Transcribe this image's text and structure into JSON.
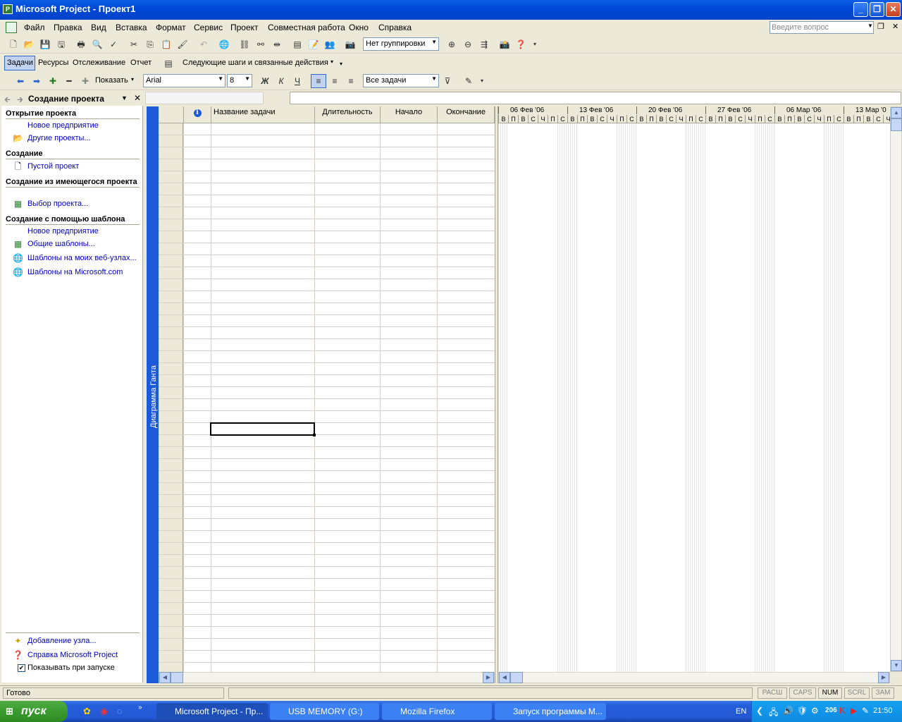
{
  "window": {
    "title": "Microsoft Project - Проект1"
  },
  "menu": {
    "items": [
      "Файл",
      "Правка",
      "Вид",
      "Вставка",
      "Формат",
      "Сервис",
      "Проект",
      "Совместная работа",
      "Окно",
      "Справка"
    ],
    "ask_placeholder": "Введите вопрос"
  },
  "toolbar1": {
    "grouping_value": "Нет группировки"
  },
  "toolbar2": {
    "tasks": "Задачи",
    "resources": "Ресурсы",
    "tracking": "Отслеживание",
    "report": "Отчет",
    "next_steps": "Следующие шаги и связанные действия"
  },
  "toolbar3": {
    "show_label": "Показать",
    "font": "Arial",
    "size": "8",
    "bold": "Ж",
    "italic": "К",
    "underline": "Ч",
    "filter": "Все задачи"
  },
  "taskpane": {
    "title": "Создание проекта",
    "sections": {
      "open": "Открытие проекта",
      "create": "Создание",
      "from_existing": "Создание из имеющегося проекта",
      "from_template": "Создание с помощью шаблона"
    },
    "links": {
      "new_enterprise1": "Новое предприятие",
      "other_projects": "Другие проекты...",
      "blank_project": "Пустой проект",
      "choose_project": "Выбор проекта...",
      "new_enterprise2": "Новое предприятие",
      "general_templates": "Общие шаблоны...",
      "web_templates": "Шаблоны на моих веб-узлах...",
      "ms_templates": "Шаблоны на Microsoft.com",
      "add_node": "Добавление узла...",
      "help": "Справка Microsoft Project"
    },
    "show_on_start": "Показывать при запуске"
  },
  "view_label": "Диаграмма Ганта",
  "grid": {
    "columns": [
      "Название задачи",
      "Длительность",
      "Начало",
      "Окончание"
    ],
    "info_icon": "i"
  },
  "gantt": {
    "weeks": [
      "06 Фев '06",
      "13 Фев '06",
      "20 Фев '06",
      "27 Фев '06",
      "06 Мар '06",
      "13 Мар '0"
    ],
    "days": [
      "В",
      "П",
      "В",
      "С",
      "Ч",
      "П",
      "С"
    ]
  },
  "status": {
    "ready": "Готово",
    "indicators": [
      "РАСШ",
      "CAPS",
      "NUM",
      "SCRL",
      "ЗАМ"
    ],
    "active_indicator": "NUM"
  },
  "taskbar": {
    "start": "пуск",
    "tasks": [
      "Microsoft Project - Пр...",
      "USB MEMORY (G:)",
      "Mozilla Firefox",
      "Запуск программы M..."
    ],
    "lang": "EN",
    "tray_num": "206",
    "clock": "21:50"
  }
}
